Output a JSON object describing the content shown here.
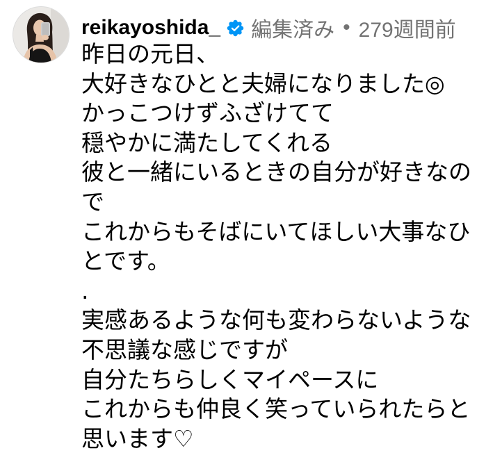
{
  "post": {
    "username": "reikayoshida_",
    "verified": true,
    "edited_label": "編集済み",
    "separator": "•",
    "time_ago": "279週間前",
    "caption_lines": [
      "昨日の元日、",
      "大好きなひとと夫婦になりました◎",
      "かっこつけずふざけてて",
      "穏やかに満たしてくれる",
      "彼と一緒にいるときの自分が好きなの",
      "で",
      "これからもそばにいてほしい大事なひ",
      "とです。",
      ".",
      "実感あるような何も変わらないような",
      "不思議な感じですが",
      "自分たちらしくマイペースに",
      "これからも仲良く笑っていられたらと",
      "思います♡"
    ]
  },
  "icons": {
    "verified": "verified-badge-icon",
    "avatar": "profile-photo"
  },
  "colors": {
    "text": "#000000",
    "meta": "#737373",
    "verified": "#0095f6",
    "background": "#ffffff"
  }
}
